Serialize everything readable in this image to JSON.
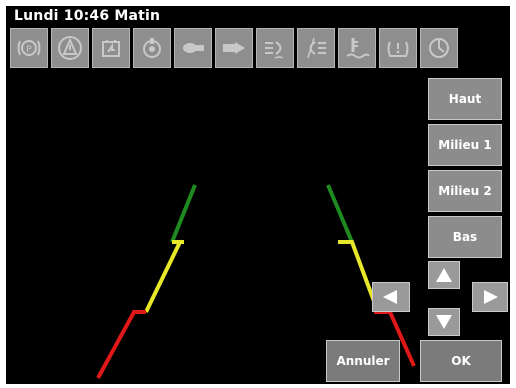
{
  "status": {
    "clock": "Lundi 10:46 Matin"
  },
  "icon_bar": [
    {
      "name": "brake-warning-icon"
    },
    {
      "name": "hazard-triangle-icon"
    },
    {
      "name": "battery-warning-icon"
    },
    {
      "name": "engine-temp-icon"
    },
    {
      "name": "headlight-low-icon"
    },
    {
      "name": "headlight-high-icon"
    },
    {
      "name": "front-fog-icon"
    },
    {
      "name": "rear-fog-icon"
    },
    {
      "name": "coolant-icon"
    },
    {
      "name": "tire-pressure-icon"
    },
    {
      "name": "engine-check-icon"
    }
  ],
  "buttons": {
    "haut": "Haut",
    "milieu1": "Milieu 1",
    "milieu2": "Milieu 2",
    "bas": "Bas",
    "annuler": "Annuler",
    "ok": "OK"
  },
  "arrows": {
    "up": "arrow-up-icon",
    "down": "arrow-down-icon",
    "left": "arrow-left-icon",
    "right": "arrow-right-icon"
  },
  "guide_colors": {
    "far": "#1f8a1f",
    "mid": "#e8e82a",
    "near": "#e01818"
  }
}
